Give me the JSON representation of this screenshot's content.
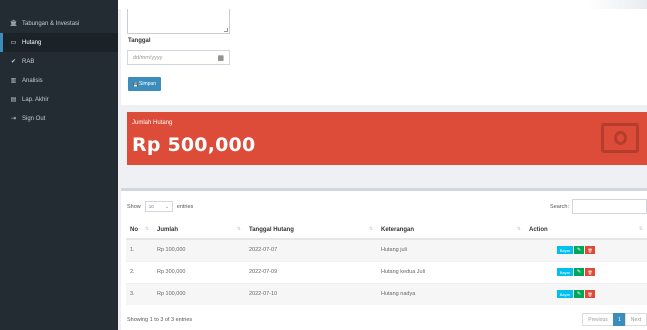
{
  "sidebar": {
    "items": [
      {
        "icon": "bank-icon",
        "glyph": "🏛",
        "label": "Tabungan & Investasi",
        "active": false
      },
      {
        "icon": "debt-card-icon",
        "glyph": "▭",
        "label": "Hutang",
        "active": true
      },
      {
        "icon": "check-icon",
        "glyph": "✔",
        "label": "RAB",
        "active": false
      },
      {
        "icon": "bar-chart-icon",
        "glyph": "▥",
        "label": "Analisis",
        "active": false
      },
      {
        "icon": "report-icon",
        "glyph": "▤",
        "label": "Lap. Akhir",
        "active": false
      },
      {
        "icon": "sign-out-icon",
        "glyph": "⇥",
        "label": "Sign Out",
        "active": false
      }
    ]
  },
  "form": {
    "date_label": "Tanggal",
    "date_placeholder": "dd/mm/yyyy",
    "calendar_glyph": "▦",
    "save_label": "Simpan",
    "save_glyph": "💾"
  },
  "summary": {
    "label": "Jumlah Hutang",
    "value": "Rp 500,000",
    "color": "#dd4b39",
    "icon": "money-icon"
  },
  "table": {
    "show_label": "Show",
    "entries_value": "10",
    "entries_label": "entries",
    "search_label": "Search:",
    "columns": [
      "No",
      "Jumlah",
      "Tanggal Hutang",
      "Keterangan",
      "Action"
    ],
    "rows": [
      {
        "no": "1.",
        "jumlah": "Rp 100,000",
        "tanggal": "2022-07-07",
        "keterangan": "Hutang juli"
      },
      {
        "no": "2.",
        "jumlah": "Rp 300,000",
        "tanggal": "2022-07-09",
        "keterangan": "Hutang kedua Juli"
      },
      {
        "no": "3.",
        "jumlah": "Rp 100,000",
        "tanggal": "2022-07-10",
        "keterangan": "Hutang nadya"
      }
    ],
    "action_pay_label": "Bayar",
    "action_edit_glyph": "✎",
    "action_delete_glyph": "🗑",
    "info": "Showing 1 to 3 of 3 entries",
    "pager": {
      "previous": "Previous",
      "page": "1",
      "next": "Next"
    }
  }
}
